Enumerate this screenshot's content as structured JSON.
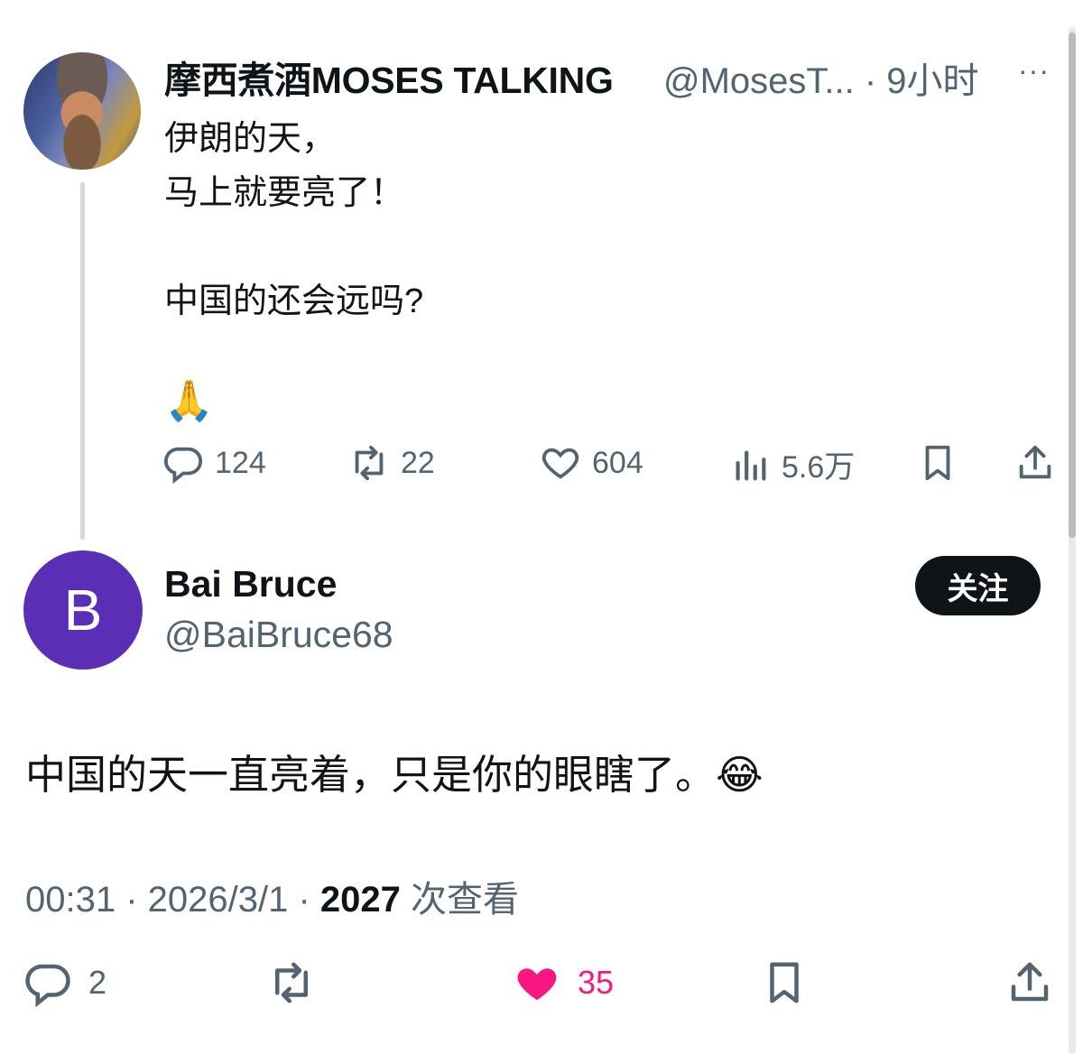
{
  "parent_tweet": {
    "author_name": "摩西煮酒MOSES TALKING",
    "handle_and_time": "@MosesT... · 9小时",
    "more_label": "···",
    "lines": [
      "伊朗的天，",
      "马上就要亮了！",
      "中国的还会远吗?",
      "🙏"
    ],
    "actions": {
      "reply_count": "124",
      "retweet_count": "22",
      "like_count": "604",
      "views_count": "5.6万"
    }
  },
  "reply_tweet": {
    "avatar_letter": "B",
    "author_name": "Bai Bruce",
    "handle": "@BaiBruce68",
    "follow_label": "关注",
    "text": "中国的天一直亮着，只是你的眼瞎了。😂",
    "timestamp": "00:31 · 2026/3/1 · ",
    "views_number": "2027",
    "views_label": " 次查看",
    "actions": {
      "reply_count": "2",
      "like_count": "35",
      "liked": true
    }
  },
  "colors": {
    "text": "#0f1419",
    "secondary": "#536471",
    "like_active": "#f91880",
    "avatar_reply": "#5b2fb5"
  },
  "icons": [
    "reply-icon",
    "retweet-icon",
    "like-icon",
    "views-icon",
    "bookmark-icon",
    "share-icon",
    "more-icon"
  ]
}
